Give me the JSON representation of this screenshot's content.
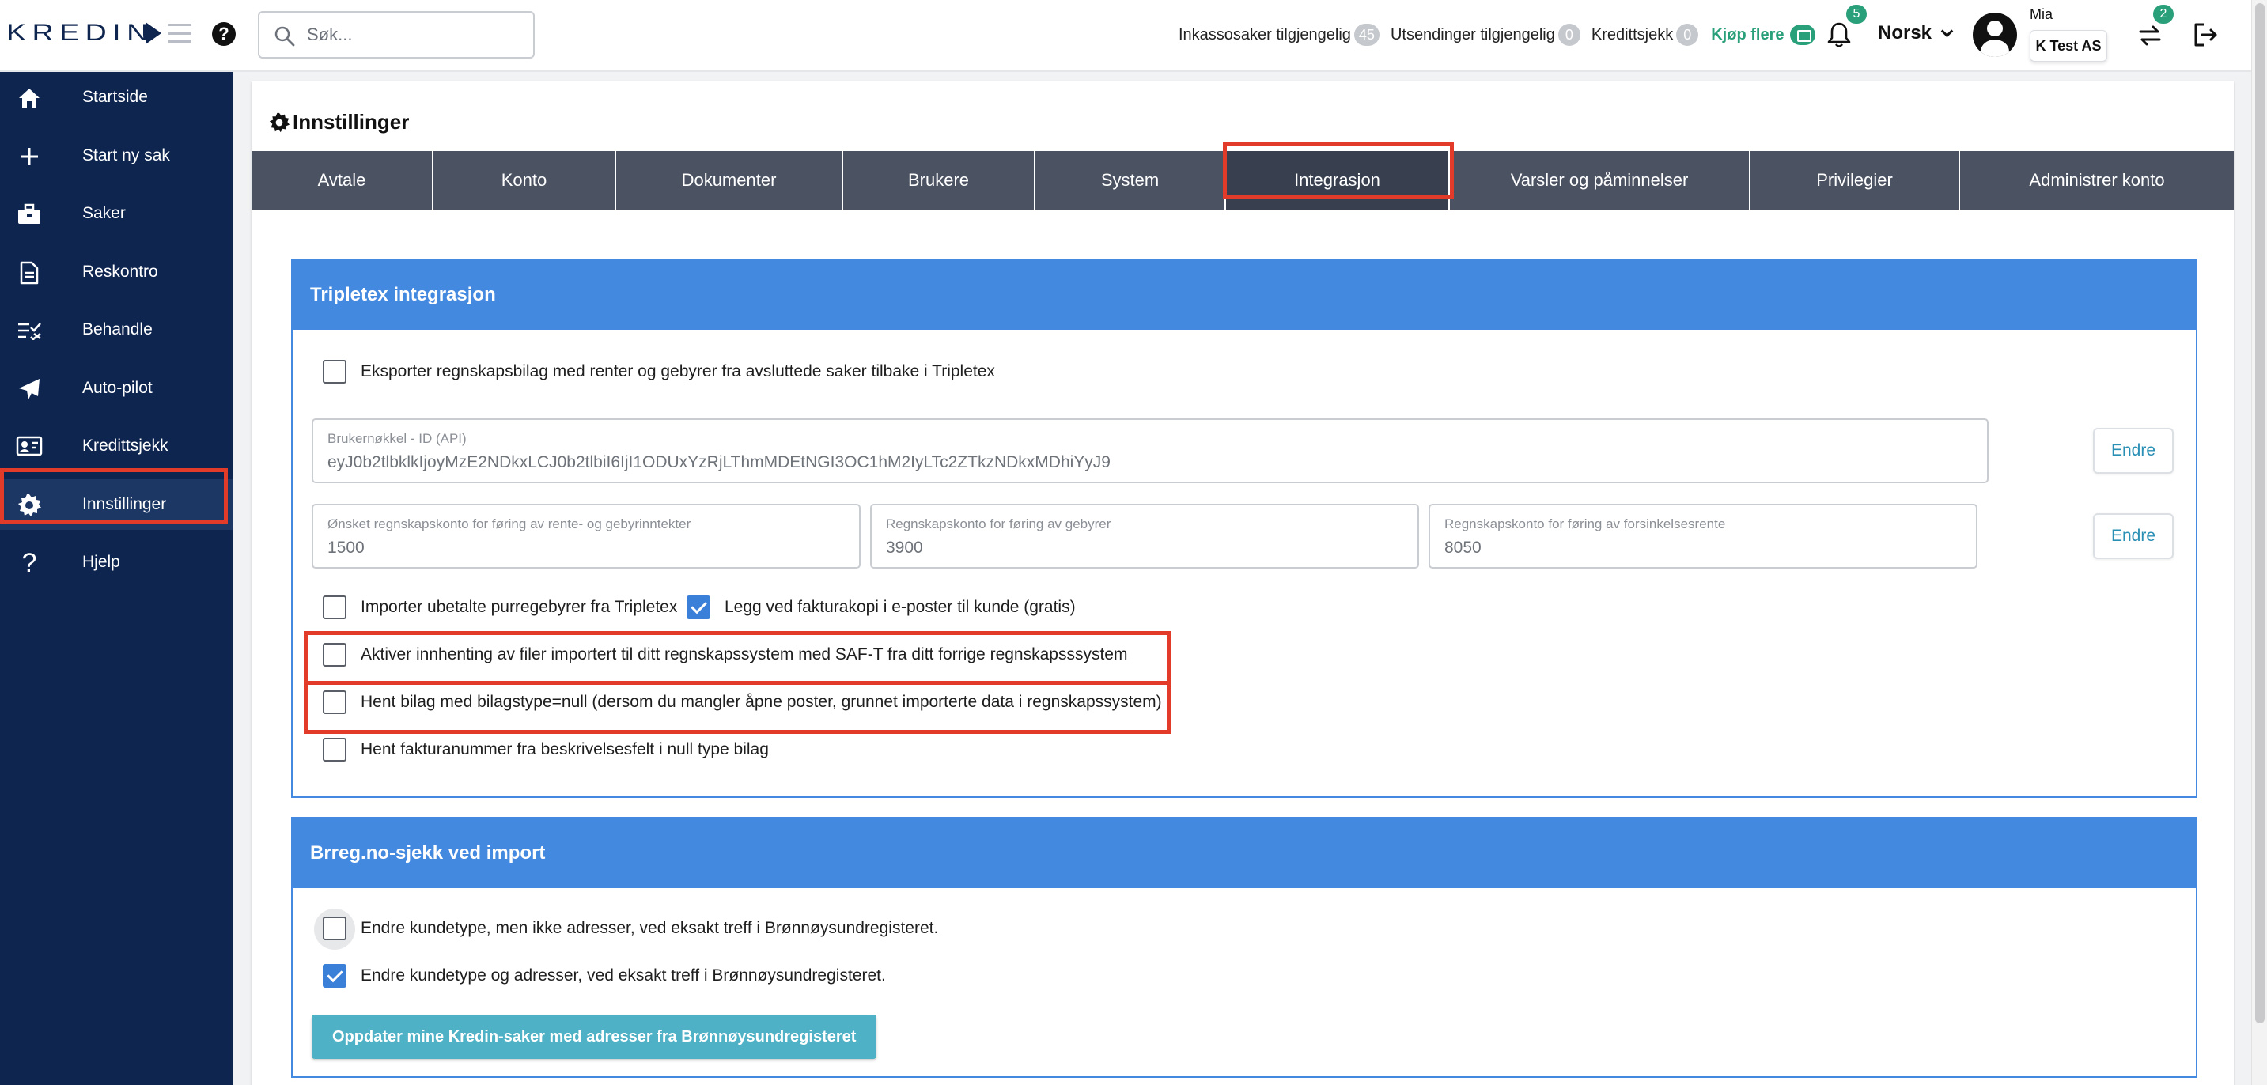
{
  "brand": {
    "logo_text": "KREDIN"
  },
  "search": {
    "placeholder": "Søk..."
  },
  "header": {
    "counters": [
      {
        "label": "Inkassosaker tilgjengelig",
        "count": "45"
      },
      {
        "label": "Utsendinger tilgjengelig",
        "count": "0"
      },
      {
        "label": "Kredittsjekk",
        "count": "0"
      }
    ],
    "buy_more": "Kjøp flere",
    "notifications_count": "5",
    "language": "Norsk",
    "user_name": "Mia",
    "company": "K Test AS",
    "switch_count": "2"
  },
  "sidebar": {
    "items": [
      {
        "label": "Startside",
        "icon": "home-icon"
      },
      {
        "label": "Start ny sak",
        "icon": "plus-icon"
      },
      {
        "label": "Saker",
        "icon": "briefcase-icon"
      },
      {
        "label": "Reskontro",
        "icon": "document-icon"
      },
      {
        "label": "Behandle",
        "icon": "checklist-icon"
      },
      {
        "label": "Auto-pilot",
        "icon": "airplane-icon"
      },
      {
        "label": "Kredittsjekk",
        "icon": "id-card-icon"
      },
      {
        "label": "Innstillinger",
        "icon": "gear-icon",
        "active": true
      },
      {
        "label": "Hjelp",
        "icon": "question-icon"
      }
    ]
  },
  "page": {
    "title": "Innstillinger"
  },
  "tabs": [
    {
      "label": "Avtale"
    },
    {
      "label": "Konto"
    },
    {
      "label": "Dokumenter"
    },
    {
      "label": "Brukere"
    },
    {
      "label": "System"
    },
    {
      "label": "Integrasjon",
      "active": true
    },
    {
      "label": "Varsler og påminnelser"
    },
    {
      "label": "Privilegier"
    },
    {
      "label": "Administrer konto"
    }
  ],
  "tripletex": {
    "title": "Tripletex integrasjon",
    "export_label": "Eksporter regnskapsbilag med renter og gebyrer fra avsluttede saker tilbake i Tripletex",
    "export_checked": false,
    "api_key": {
      "label": "Brukernøkkel - ID (API)",
      "value": "eyJ0b2tlbklkIjoyMzE2NDkxLCJ0b2tlbiI6IjI1ODUxYzRjLThmMDEtNGI3OC1hM2IyLTc2ZTkzNDkxMDhiYyJ9"
    },
    "endre_label": "Endre",
    "accounts": [
      {
        "label": "Ønsket regnskapskonto for føring av rente- og gebyrinntekter",
        "value": "1500"
      },
      {
        "label": "Regnskapskonto for føring av gebyrer",
        "value": "3900"
      },
      {
        "label": "Regnskapskonto for føring av forsinkelsesrente",
        "value": "8050"
      }
    ],
    "options": [
      {
        "label": "Importer ubetalte purregebyrer fra Tripletex",
        "checked": false
      },
      {
        "label": "Legg ved fakturakopi i e-poster til kunde (gratis)",
        "checked": true
      },
      {
        "label": "Aktiver innhenting av filer importert til ditt regnskapssystem med SAF-T fra ditt forrige regnskapsssystem",
        "checked": false
      },
      {
        "label": "Hent bilag med bilagstype=null (dersom du mangler åpne poster, grunnet importerte data i regnskapssystem)",
        "checked": false
      },
      {
        "label": "Hent fakturanummer fra beskrivelsesfelt i null type bilag",
        "checked": false
      }
    ]
  },
  "brreg": {
    "title": "Brreg.no-sjekk ved import",
    "options": [
      {
        "label": "Endre kundetype, men ikke adresser, ved eksakt treff i Brønnøysundregisteret.",
        "checked": false
      },
      {
        "label": "Endre kundetype og adresser, ved eksakt treff i Brønnøysundregisteret.",
        "checked": true
      }
    ],
    "update_button": "Oppdater mine Kredin-saker med adresser fra Brønnøysundregisteret"
  },
  "colors": {
    "sidebar_bg": "#0e2550",
    "tab_bar": "#4b5262",
    "card_header": "#4389e0",
    "accent_green": "#2aa07a",
    "highlight_red": "#e23b2a",
    "button_teal": "#4fb1c5"
  }
}
